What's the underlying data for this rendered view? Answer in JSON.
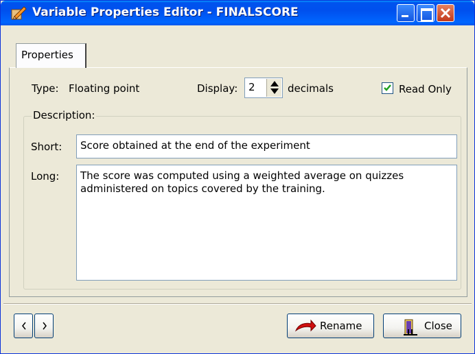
{
  "window": {
    "title": "Variable Properties Editor - FINALSCORE",
    "controls": [
      "minimize-icon",
      "maximize-icon",
      "close-icon"
    ]
  },
  "tabs": [
    {
      "label": "Properties",
      "active": true
    }
  ],
  "type_row": {
    "type_label": "Type:",
    "type_value": "Floating point",
    "display_label": "Display:",
    "display_value": "2",
    "decimals_label": "decimals",
    "read_only_label": "Read Only",
    "read_only_checked": true
  },
  "description": {
    "group_title": "Description:",
    "short_label": "Short:",
    "short_value": "Score obtained at the end of the experiment",
    "long_label": "Long:",
    "long_value": "The score was computed using a weighted average on quizzes\nadministered on topics covered by the training."
  },
  "footer": {
    "rename_label": "Rename",
    "close_label": "Close"
  },
  "colors": {
    "titlebar": "#0054e3",
    "face": "#ece9d8",
    "checkmark": "#21a121"
  }
}
